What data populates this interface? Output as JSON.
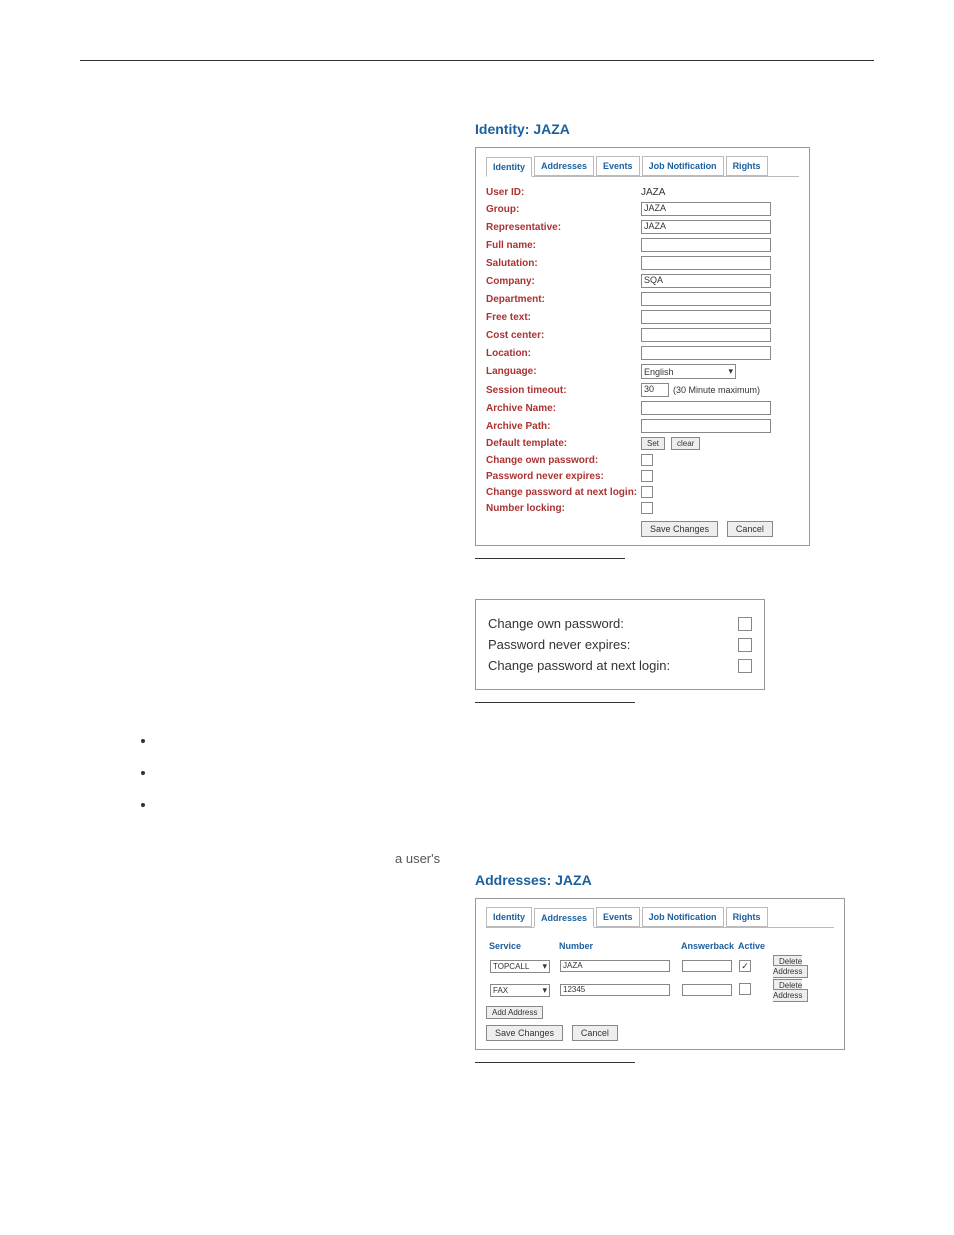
{
  "identityPanel": {
    "title": "Identity: JAZA",
    "tabs": [
      "Identity",
      "Addresses",
      "Events",
      "Job Notification",
      "Rights"
    ],
    "activeTab": 0,
    "rows": {
      "userId": {
        "label": "User ID:",
        "value": "JAZA"
      },
      "group": {
        "label": "Group:",
        "value": "JAZA"
      },
      "representative": {
        "label": "Representative:",
        "value": "JAZA"
      },
      "fullName": {
        "label": "Full name:",
        "value": ""
      },
      "salutation": {
        "label": "Salutation:",
        "value": ""
      },
      "company": {
        "label": "Company:",
        "value": "SQA"
      },
      "department": {
        "label": "Department:",
        "value": ""
      },
      "freeText": {
        "label": "Free text:",
        "value": ""
      },
      "costCenter": {
        "label": "Cost center:",
        "value": ""
      },
      "location": {
        "label": "Location:",
        "value": ""
      },
      "language": {
        "label": "Language:",
        "value": "English"
      },
      "sessionTimeout": {
        "label": "Session timeout:",
        "value": "30",
        "hint": "(30 Minute maximum)"
      },
      "archiveName": {
        "label": "Archive Name:",
        "value": ""
      },
      "archivePath": {
        "label": "Archive Path:",
        "value": ""
      },
      "defaultTemplate": {
        "label": "Default template:",
        "setBtn": "Set",
        "clearBtn": "clear"
      },
      "changeOwnPassword": {
        "label": "Change own password:"
      },
      "passwordNeverExpires": {
        "label": "Password never expires:"
      },
      "changePasswordNextLogin": {
        "label": "Change password at next login:"
      },
      "numberLocking": {
        "label": "Number locking:"
      }
    },
    "saveBtn": "Save Changes",
    "cancelBtn": "Cancel"
  },
  "zoomBox": {
    "row1": "Change own password:",
    "row2": "Password never expires:",
    "row3": "Change password at next login:"
  },
  "floatText": "a user's",
  "addressesPanel": {
    "title": "Addresses: JAZA",
    "tabs": [
      "Identity",
      "Addresses",
      "Events",
      "Job Notification",
      "Rights"
    ],
    "activeTab": 1,
    "headers": {
      "service": "Service",
      "number": "Number",
      "answerback": "Answerback",
      "active": "Active"
    },
    "rows": [
      {
        "service": "TOPCALL",
        "number": "JAZA",
        "active": true
      },
      {
        "service": "FAX",
        "number": "12345",
        "active": false
      }
    ],
    "addAddressBtn": "Add Address",
    "deleteBtn": "Delete Address",
    "saveBtn": "Save Changes",
    "cancelBtn": "Cancel"
  }
}
